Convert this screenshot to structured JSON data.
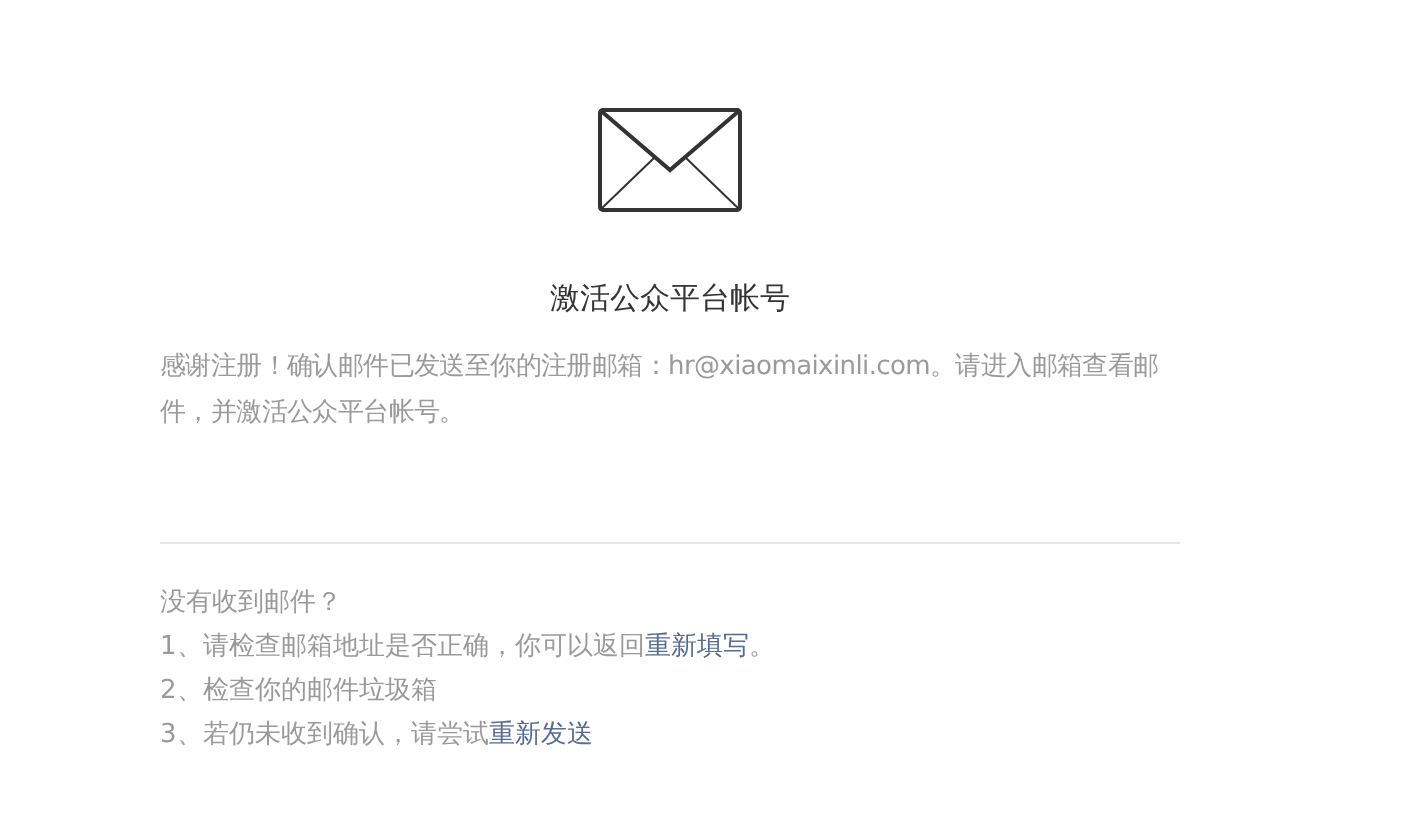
{
  "title": "激活公众平台帐号",
  "description": "感谢注册！确认邮件已发送至你的注册邮箱：hr@xiaomaixinli.com。请进入邮箱查看邮件，并激活公众平台帐号。",
  "help": {
    "heading": "没有收到邮件？",
    "items": [
      {
        "parts": [
          {
            "kind": "text",
            "text": "1、请检查邮箱地址是否正确，你可以返回"
          },
          {
            "kind": "link",
            "text": "重新填写"
          },
          {
            "kind": "text",
            "text": "。"
          }
        ]
      },
      {
        "parts": [
          {
            "kind": "text",
            "text": "2、检查你的邮件垃圾箱"
          }
        ]
      },
      {
        "parts": [
          {
            "kind": "text",
            "text": "3、若仍未收到确认，请尝试"
          },
          {
            "kind": "link",
            "text": "重新发送"
          }
        ]
      }
    ]
  }
}
